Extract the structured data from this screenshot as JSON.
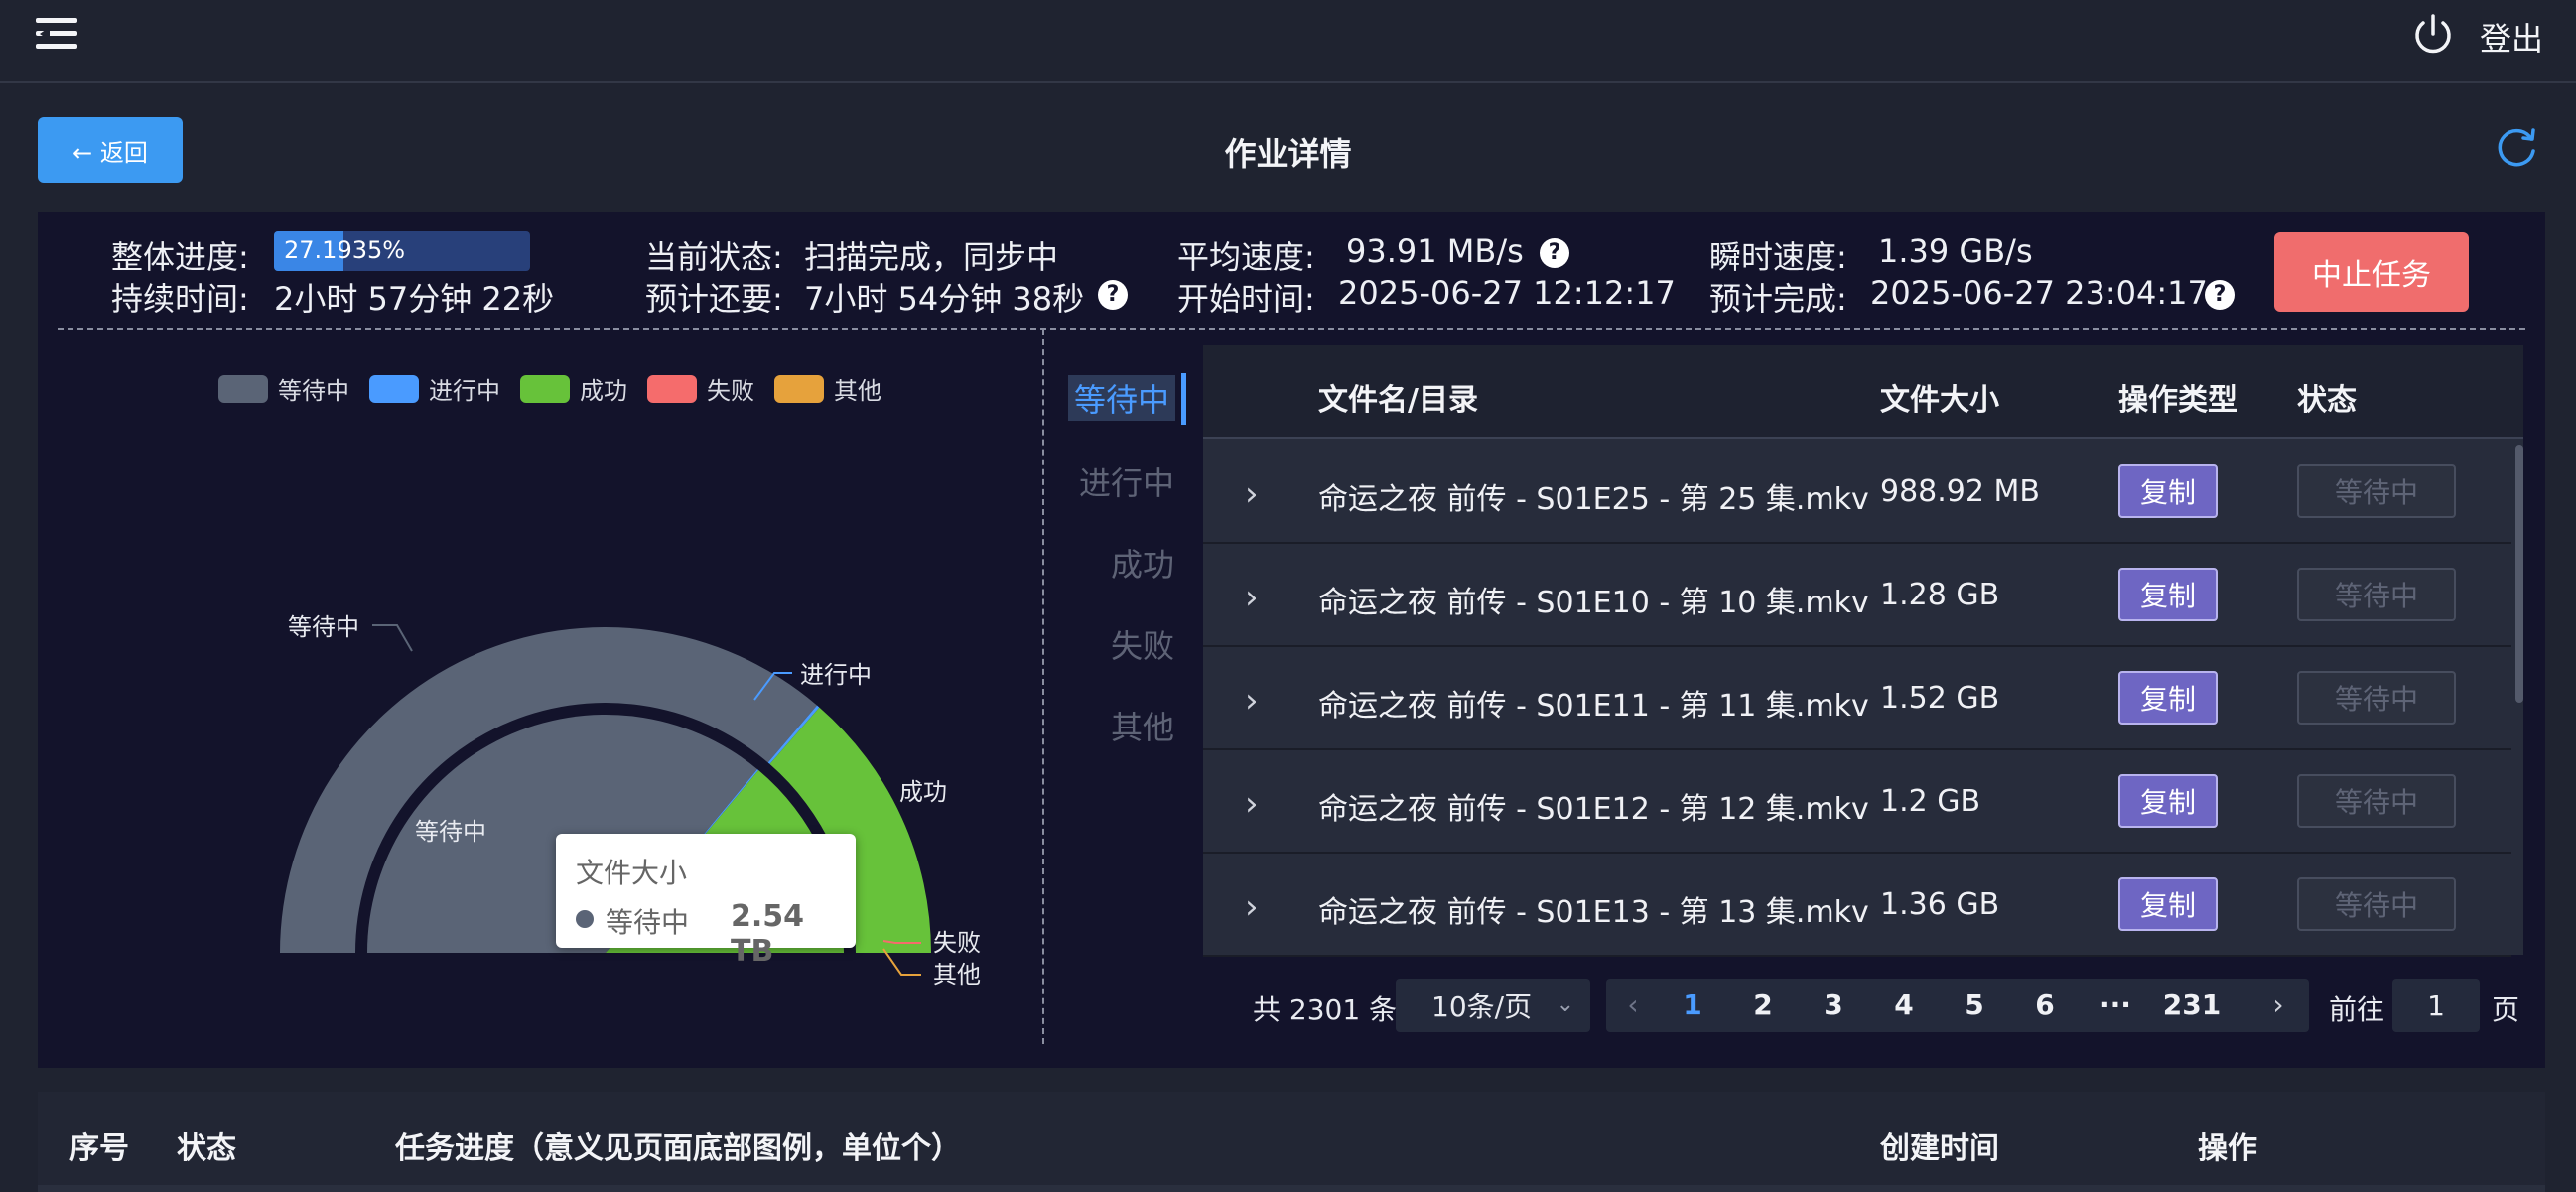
{
  "header": {
    "logout_label": "登出",
    "menu_icon": "menu-fold-icon",
    "power_icon": "power-icon"
  },
  "page": {
    "back_label": "← 返回",
    "title": "作业详情",
    "refresh_icon": "refresh-icon"
  },
  "stats": {
    "overall_progress_label": "整体进度:",
    "overall_progress_text": "27.1935%",
    "overall_progress_value": 0.271935,
    "duration_label": "持续时间:",
    "duration_value": "2小时 57分钟 22秒",
    "current_state_label": "当前状态:",
    "current_state_value": "扫描完成，同步中",
    "remaining_label": "预计还要:",
    "remaining_value": "7小时 54分钟 38秒",
    "avg_speed_label": "平均速度:",
    "avg_speed_value": "93.91 MB/s",
    "start_time_label": "开始时间:",
    "start_time_value": "2025-06-27 12:12:17",
    "instant_speed_label": "瞬时速度:",
    "instant_speed_value": "1.39 GB/s",
    "eta_label": "预计完成:",
    "eta_value": "2025-06-27 23:04:17",
    "help_glyph": "?",
    "stop_label": "中止任务"
  },
  "chart_data": {
    "type": "pie",
    "variant": "half-donut with inner half-pie",
    "legend": [
      "等待中",
      "进行中",
      "成功",
      "失败",
      "其他"
    ],
    "colors": {
      "等待中": "#5a6476",
      "进行中": "#4a9bff",
      "成功": "#67c23a",
      "失败": "#f56c6c",
      "其他": "#e6a23c"
    },
    "outer_labels": [
      "等待中",
      "进行中",
      "成功",
      "失败",
      "其他"
    ],
    "inner_labels": [
      "等待中"
    ],
    "tooltip": {
      "title": "文件大小",
      "series": "等待中",
      "value": "2.54 TB"
    },
    "outer_series": [
      {
        "name": "等待中",
        "value": 72.5
      },
      {
        "name": "进行中",
        "value": 0.3
      },
      {
        "name": "成功",
        "value": 27.2
      },
      {
        "name": "失败",
        "value": 0
      },
      {
        "name": "其他",
        "value": 0
      }
    ],
    "inner_series": [
      {
        "name": "等待中",
        "value": 72
      },
      {
        "name": "进行中",
        "value": 0.2
      },
      {
        "name": "成功",
        "value": 27.8
      },
      {
        "name": "失败",
        "value": 0
      },
      {
        "name": "其他",
        "value": 0
      }
    ]
  },
  "filter_tabs": [
    {
      "label": "等待中",
      "active": true
    },
    {
      "label": "进行中",
      "active": false
    },
    {
      "label": "成功",
      "active": false
    },
    {
      "label": "失败",
      "active": false
    },
    {
      "label": "其他",
      "active": false
    }
  ],
  "file_table": {
    "columns": [
      "文件名/目录",
      "文件大小",
      "操作类型",
      "状态"
    ],
    "rows": [
      {
        "name": "命运之夜 前传 - S01E25 - 第 25 集.mkv",
        "size": "988.92 MB",
        "op": "复制",
        "status": "等待中"
      },
      {
        "name": "命运之夜 前传 - S01E10 - 第 10 集.mkv",
        "size": "1.28 GB",
        "op": "复制",
        "status": "等待中"
      },
      {
        "name": "命运之夜 前传 - S01E11 - 第 11 集.mkv",
        "size": "1.52 GB",
        "op": "复制",
        "status": "等待中"
      },
      {
        "name": "命运之夜 前传 - S01E12 - 第 12 集.mkv",
        "size": "1.2 GB",
        "op": "复制",
        "status": "等待中"
      },
      {
        "name": "命运之夜 前传 - S01E13 - 第 13 集.mkv",
        "size": "1.36 GB",
        "op": "复制",
        "status": "等待中"
      }
    ],
    "expand_glyph": "›"
  },
  "pagination": {
    "total_text": "共 2301 条",
    "page_size": "10条/页",
    "prev_glyph": "‹",
    "next_glyph": "›",
    "pages": [
      "1",
      "2",
      "3",
      "4",
      "5",
      "6",
      "···",
      "231"
    ],
    "current": "1",
    "goto_label": "前往",
    "goto_value": "1",
    "goto_unit": "页"
  },
  "task_table": {
    "columns": [
      "序号",
      "状态",
      "任务进度（意义见页面底部图例，单位个）",
      "创建时间",
      "操作"
    ]
  }
}
